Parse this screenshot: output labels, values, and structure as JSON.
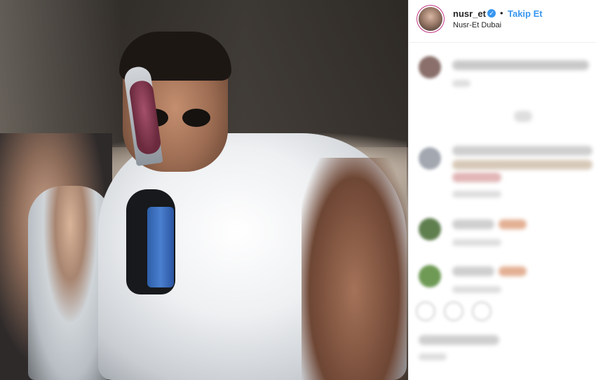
{
  "post": {
    "username": "nusr_et",
    "verified_mark": "✓",
    "separator": "•",
    "follow_label": "Takip Et",
    "location": "Nusr-Et Dubai"
  },
  "colors": {
    "link_blue": "#3897f0",
    "text": "#262626",
    "border": "#efefef"
  },
  "icons": [
    "verified-badge-icon",
    "like-icon",
    "comment-icon",
    "share-icon"
  ]
}
